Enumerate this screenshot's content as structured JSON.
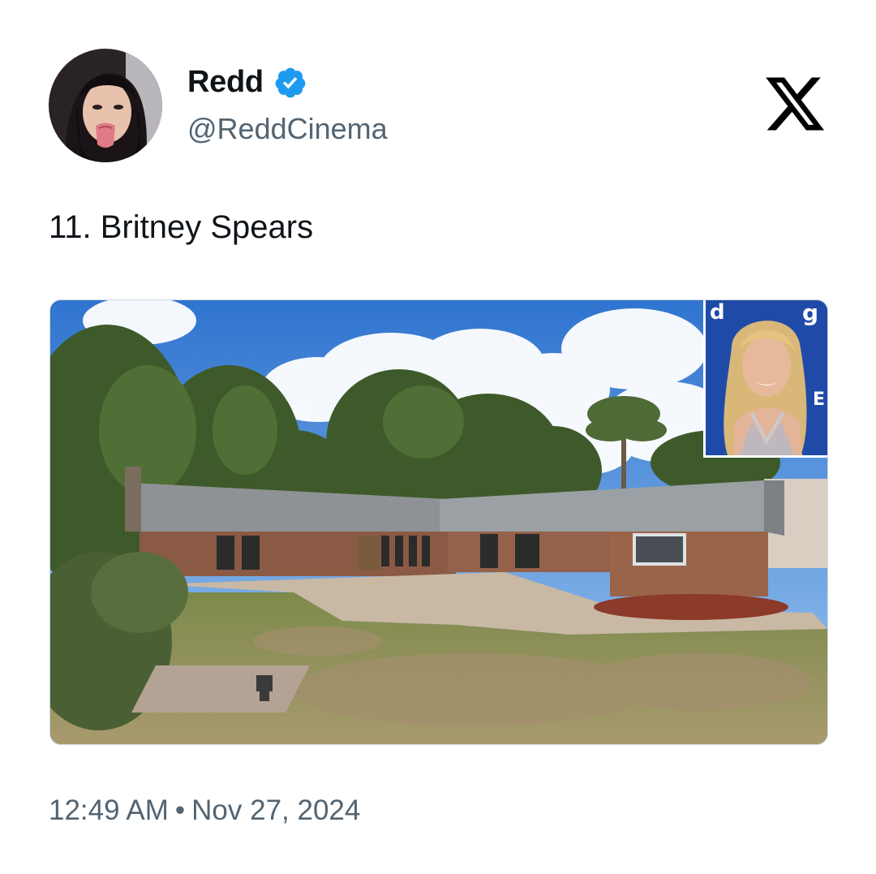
{
  "author": {
    "display_name": "Redd",
    "handle": "@ReddCinema",
    "verified": true,
    "avatar_icon": "user-avatar-photo",
    "verified_icon": "verified-badge-icon"
  },
  "platform": {
    "logo_icon": "x-logo-icon"
  },
  "tweet": {
    "text": "11. Britney Spears",
    "media": {
      "description_icon": "house-photo",
      "inset_icon": "celebrity-portrait-inset",
      "inset_backdrop_letters": [
        "d",
        "g",
        "E"
      ]
    }
  },
  "meta": {
    "time": "12:49 AM",
    "separator": "•",
    "date": "Nov 27, 2024"
  },
  "colors": {
    "text_primary": "#0f1419",
    "text_secondary": "#536471",
    "verified_blue": "#1d9bf0",
    "border": "#cfd9de"
  }
}
